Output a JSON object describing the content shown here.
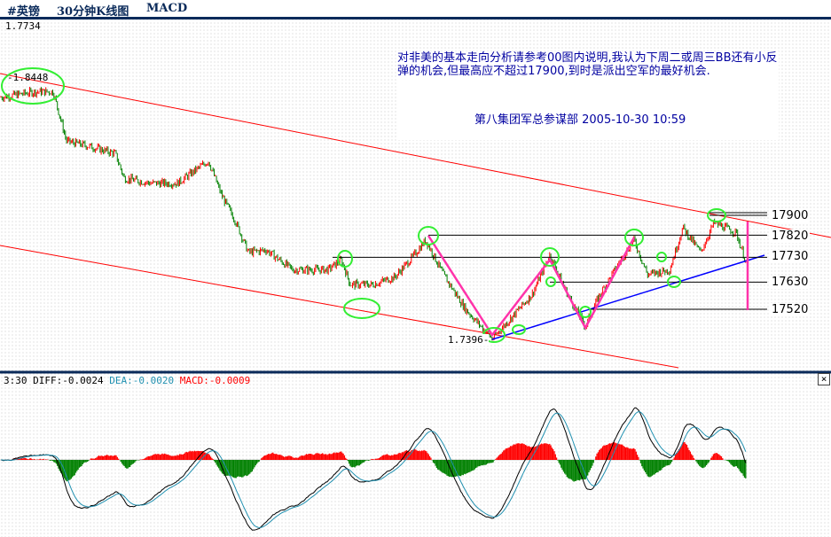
{
  "header": {
    "symbol": "#英镑",
    "period": "30分钟K线图",
    "indicator": "MACD"
  },
  "price_panel": {
    "top_label": "1.7734",
    "high_label": "-1.8448",
    "low_label": "1.7396-"
  },
  "note": {
    "text": "对非美的基本走向分析请参考00图内说明,我认为下周二或周三BB还有小反弹的机会,但最高应不超过17900,到时是派出空军的最好机会.",
    "signature": "第八集团军总参谋部  2005-10-30   10:59"
  },
  "macd_panel": {
    "time": "3:30",
    "diff": "DIFF:-0.0024",
    "dea": "DEA:-0.0020",
    "macd": "MACD:-0.0009",
    "close": "×"
  },
  "colors": {
    "up": "#ff0000",
    "down": "#008000",
    "channel": "#ff0000",
    "support": "#0000ff",
    "zigzag": "#ff33aa",
    "circle": "#33ee33",
    "dea": "#2090b0",
    "macd": "#ff0000",
    "frame": "#0a2a5a"
  },
  "chart_data": {
    "type": "candlestick",
    "levels": [
      17900,
      17820,
      17730,
      17630,
      17520
    ],
    "high": 1.8448,
    "low": 1.7396,
    "price_path": [
      18380,
      18400,
      18400,
      18200,
      18180,
      18150,
      18050,
      18030,
      18030,
      18120,
      17980,
      17880,
      17750,
      17760,
      17680,
      17680,
      17720,
      17620,
      17620,
      17650,
      17730,
      17800,
      17660,
      17520,
      17400,
      17500,
      17580,
      17740,
      17580,
      17450,
      17570,
      17720,
      17800,
      17660,
      17680,
      17850,
      17750,
      17870,
      17830,
      17700
    ],
    "macd_last": {
      "diff": -0.0024,
      "dea": -0.002,
      "macd": -0.0009
    }
  }
}
